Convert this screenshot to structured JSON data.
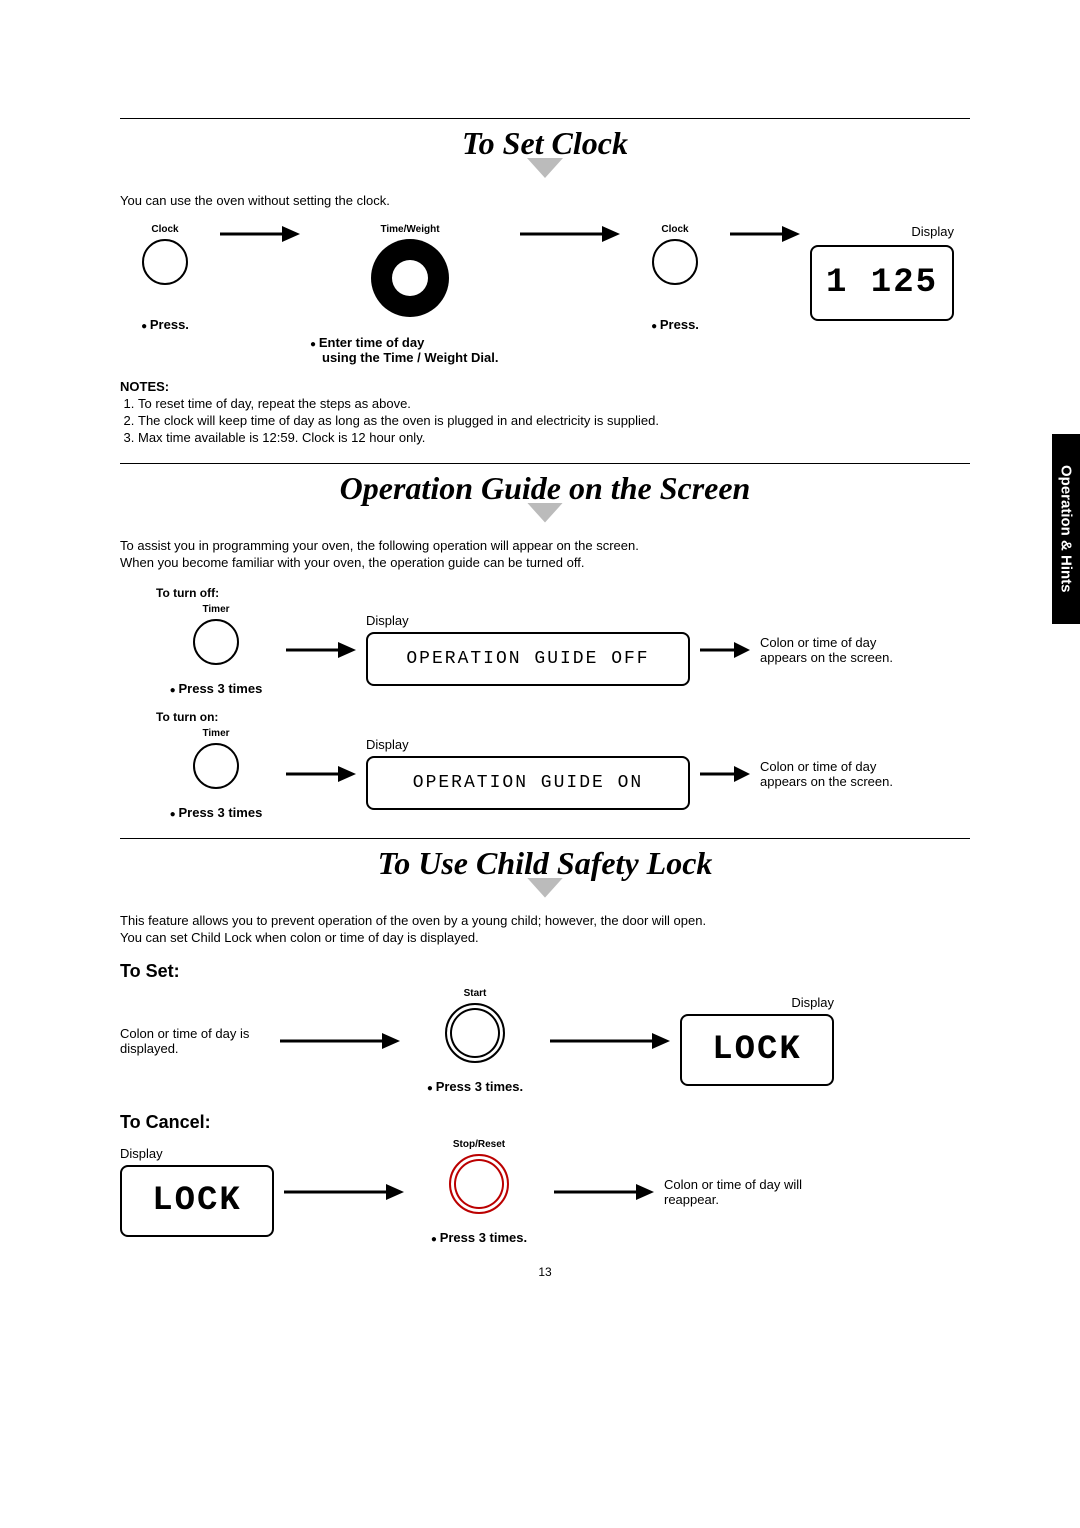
{
  "side_tab": "Operation & Hints",
  "page_number": "13",
  "section1": {
    "title": "To Set Clock",
    "intro": "You can use the oven without setting the clock.",
    "step1_top": "Clock",
    "step1_label": "Press.",
    "step2_top": "Time/Weight",
    "step2_label1": "Enter time of day",
    "step2_label2": "using the Time / Weight Dial.",
    "step3_top": "Clock",
    "step3_label": "Press.",
    "display_label": "Display",
    "display_value": "1 125",
    "notes_h": "NOTES:",
    "notes": [
      "To reset time of day, repeat the steps as above.",
      "The clock will keep time of day as long as the oven is plugged in and electricity is supplied.",
      "Max time available is 12:59. Clock is 12 hour only."
    ]
  },
  "section2": {
    "title": "Operation Guide on the Screen",
    "intro": "To assist you in programming your oven, the following operation will appear on the screen.\nWhen you become familiar with your oven, the operation guide can be turned off.",
    "off_h": "To turn off:",
    "on_h": "To turn on:",
    "timer_top": "Timer",
    "press3": "Press 3 times",
    "display_label": "Display",
    "off_text": "OPERATION GUIDE OFF",
    "on_text": "OPERATION GUIDE ON",
    "result": "Colon or time of day appears on the screen."
  },
  "section3": {
    "title": "To Use Child Safety Lock",
    "intro": "This feature allows you to prevent operation of the oven by a young child; however, the door will open.\nYou can set Child Lock when colon or time of day is displayed.",
    "set_h": "To Set:",
    "cancel_h": "To Cancel:",
    "colon_text": "Colon or time of day is displayed.",
    "start_top": "Start",
    "stop_top": "Stop/Reset",
    "press3": "Press 3 times.",
    "display_label": "Display",
    "lock_text": "LOCK",
    "result": "Colon or time of day will reappear."
  }
}
